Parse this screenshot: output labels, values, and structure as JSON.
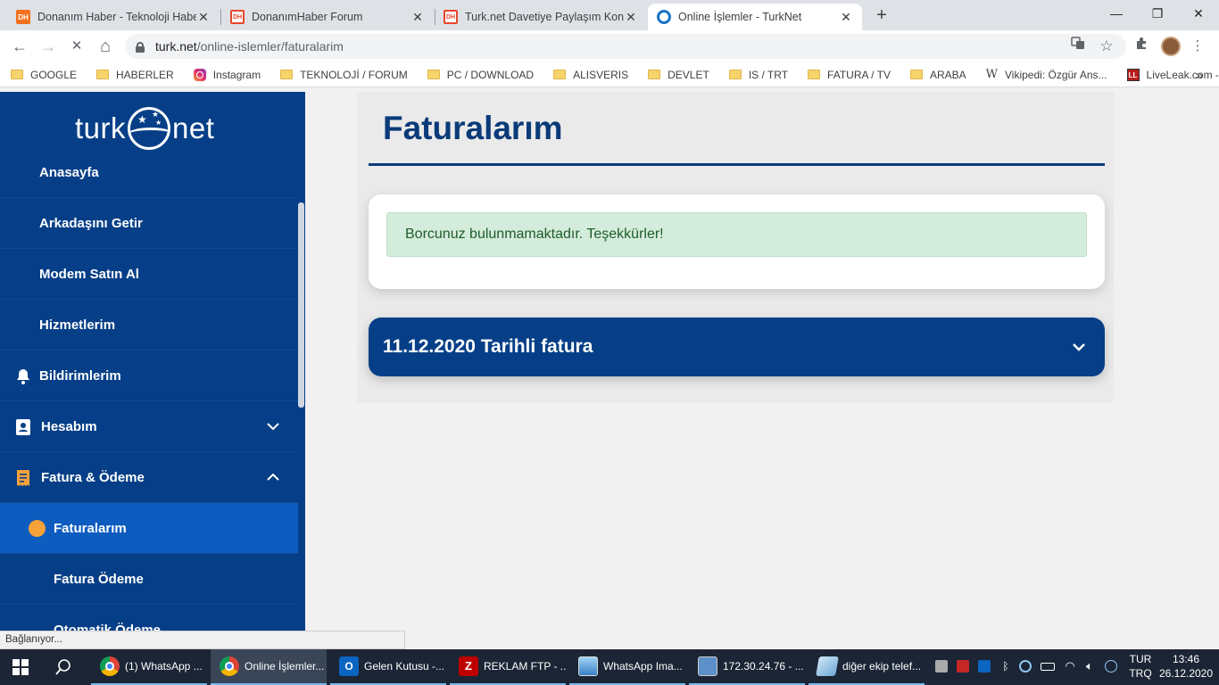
{
  "browser": {
    "tabs": [
      {
        "title": "Donanım Haber - Teknoloji Haber",
        "favicon": "dh-icon",
        "close": "✕"
      },
      {
        "title": "DonanımHaber Forum",
        "favicon": "dh-forum-icon",
        "close": "✕"
      },
      {
        "title": "Turk.net Davetiye Paylaşım Konu",
        "favicon": "dh-forum-icon",
        "close": "✕"
      },
      {
        "title": "Online İşlemler - TurkNet",
        "favicon": "turknet-icon",
        "close": "✕"
      }
    ],
    "new_tab": "+",
    "window_controls": {
      "minimize": "—",
      "restore": "❐",
      "close": "✕"
    },
    "nav": {
      "back": "←",
      "forward": "→",
      "reload": "✕",
      "home": "⌂"
    },
    "url": {
      "host": "turk.net",
      "path": "/online-islemler/faturalarim"
    },
    "bookmarks": [
      {
        "label": "GOOGLE",
        "icon": "folder"
      },
      {
        "label": "HABERLER",
        "icon": "folder"
      },
      {
        "label": "Instagram",
        "icon": "instagram"
      },
      {
        "label": "TEKNOLOJİ / FORUM",
        "icon": "folder"
      },
      {
        "label": "PC / DOWNLOAD",
        "icon": "folder"
      },
      {
        "label": "ALISVERIS",
        "icon": "folder"
      },
      {
        "label": "DEVLET",
        "icon": "folder"
      },
      {
        "label": "IS / TRT",
        "icon": "folder"
      },
      {
        "label": "FATURA / TV",
        "icon": "folder"
      },
      {
        "label": "ARABA",
        "icon": "folder"
      },
      {
        "label": "Vikipedi: Özgür Ans...",
        "icon": "wikipedia"
      },
      {
        "label": "LiveLeak.com - Red...",
        "icon": "liveleak"
      }
    ],
    "bookmarks_more": "»",
    "status_text": "Bağlanıyor..."
  },
  "sidebar": {
    "logo": {
      "left": "turk",
      "right": "net"
    },
    "items": [
      {
        "label": "Anasayfa"
      },
      {
        "label": "Arkadaşını Getir"
      },
      {
        "label": "Modem Satın Al"
      },
      {
        "label": "Hizmetlerim"
      },
      {
        "label": "Bildirimlerim",
        "icon": "bell-icon"
      },
      {
        "label": "Hesabım",
        "icon": "contact-card-icon",
        "chevron": "down"
      },
      {
        "label": "Fatura & Ödeme",
        "icon": "receipt-icon",
        "chevron": "up"
      },
      {
        "label": "Faturalarım",
        "active": true
      },
      {
        "label": "Fatura Ödeme"
      },
      {
        "label": "Otomatik Ödeme"
      }
    ]
  },
  "main": {
    "title": "Faturalarım",
    "alert": "Borcunuz bulunmamaktadır. Teşekkürler!",
    "invoice_title": "11.12.2020 Tarihli fatura"
  },
  "taskbar": {
    "items": [
      {
        "label": "(1) WhatsApp ...",
        "icon": "chrome-icon"
      },
      {
        "label": "Online İşlemler...",
        "icon": "chrome-icon",
        "active": true
      },
      {
        "label": "Gelen Kutusu -...",
        "icon": "outlook-icon"
      },
      {
        "label": "REKLAM FTP - ...",
        "icon": "filezilla-icon"
      },
      {
        "label": "WhatsApp Ima...",
        "icon": "image-viewer-icon"
      },
      {
        "label": "172.30.24.76 - ...",
        "icon": "remote-desktop-icon"
      },
      {
        "label": "diğer ekip telef...",
        "icon": "notepad-icon"
      }
    ],
    "language": {
      "line1": "TUR",
      "line2": "TRQ"
    },
    "clock": {
      "time": "13:46",
      "date": "26.12.2020"
    }
  },
  "colors": {
    "sidebar_bg": "#063f87",
    "active_item": "#0d5cbf",
    "title_color": "#0a3b79",
    "alert_bg": "#d4ecdb",
    "accent_dot": "#f6a23a"
  }
}
